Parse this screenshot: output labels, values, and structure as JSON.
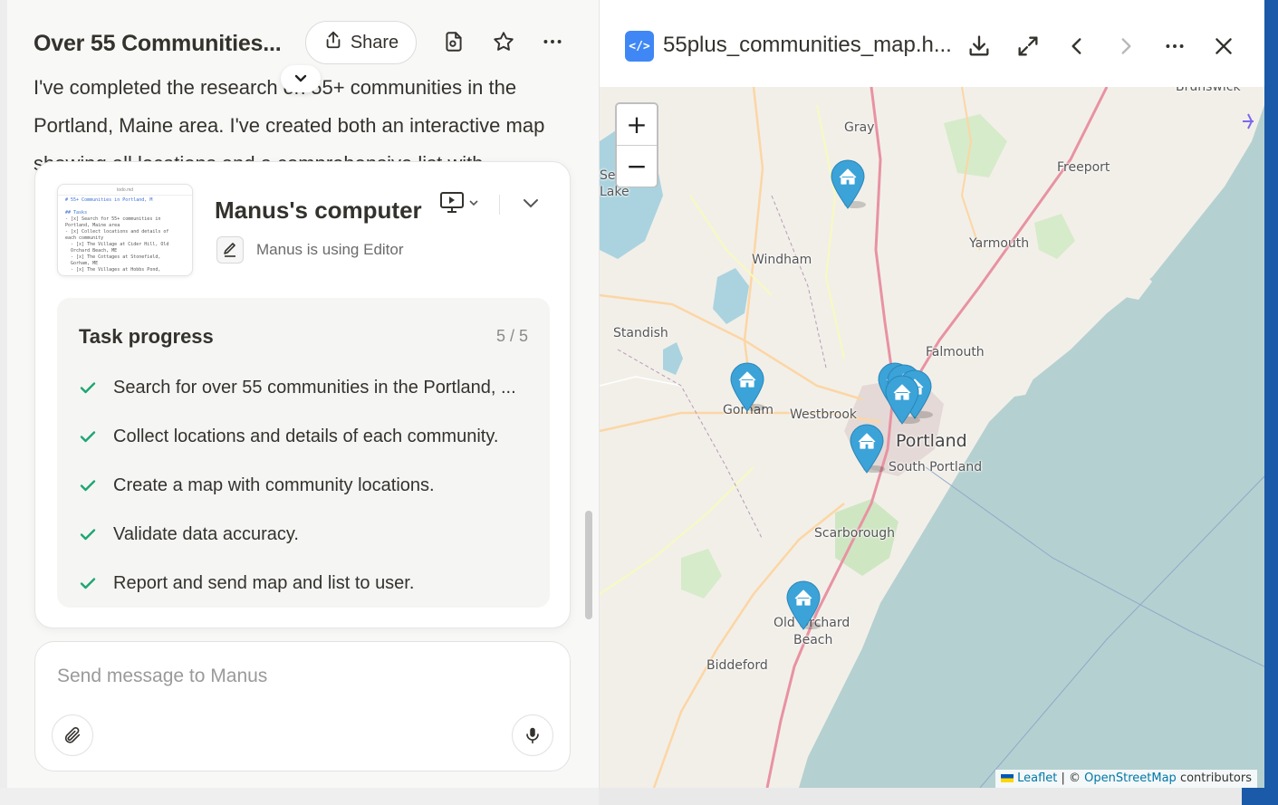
{
  "task": {
    "title": "Over 55 Communities...",
    "share_label": "Share",
    "message": "I've completed the research on 55+ communities in the Portland, Maine area. I've created both an interactive map showing all locations and a comprehensive list with"
  },
  "computer": {
    "title": "Manus's computer",
    "status": "Manus is using Editor",
    "thumbnail": {
      "filename": "todo.md",
      "badge": "Modified",
      "lines": [
        "# 55+ Communities in Portland, M",
        "",
        "## Tasks",
        "- [x] Search for 55+ communities in",
        "Portland, Maine area",
        "- [x] Collect locations and details of",
        "each community",
        "  - [x] The Village at Cider Hill, Old",
        "  Orchard Beach, ME",
        "  - [x] The Cottages at Stonefield,",
        "  Gorham, ME",
        "  - [x] The Villages at Hobbs Pond,"
      ]
    }
  },
  "progress": {
    "title": "Task progress",
    "count": "5 / 5",
    "items": [
      {
        "label": "Search for over 55 communities in the Portland, ...",
        "done": true
      },
      {
        "label": "Collect locations and details of each community.",
        "done": true
      },
      {
        "label": "Create a map with community locations.",
        "done": true
      },
      {
        "label": "Validate data accuracy.",
        "done": true
      },
      {
        "label": "Report and send map and list to user.",
        "done": true
      }
    ]
  },
  "composer": {
    "placeholder": "Send message to Manus"
  },
  "viewer": {
    "file_name": "55plus_communities_map.h...",
    "zoom_in": "+",
    "zoom_out": "−",
    "attribution": {
      "leaflet": "Leaflet",
      "sep": " | © ",
      "osm": "OpenStreetMap",
      "suffix": " contributors"
    },
    "places": [
      "Brunswick",
      "Gray",
      "Freeport",
      "Yarmouth",
      "Windham",
      "Standish",
      "Falmouth",
      "Gorham",
      "Westbrook",
      "Portland",
      "South Portland",
      "Scarborough",
      "Old Orchard",
      "Beach",
      "Biddeford",
      "Sebago",
      "Lake"
    ],
    "marker_count": 8
  },
  "colors": {
    "accent": "#3f87f5",
    "marker": "#3ba3d8",
    "check": "#1ea672",
    "water": "#b5d0d0",
    "land": "#f2efe9"
  }
}
